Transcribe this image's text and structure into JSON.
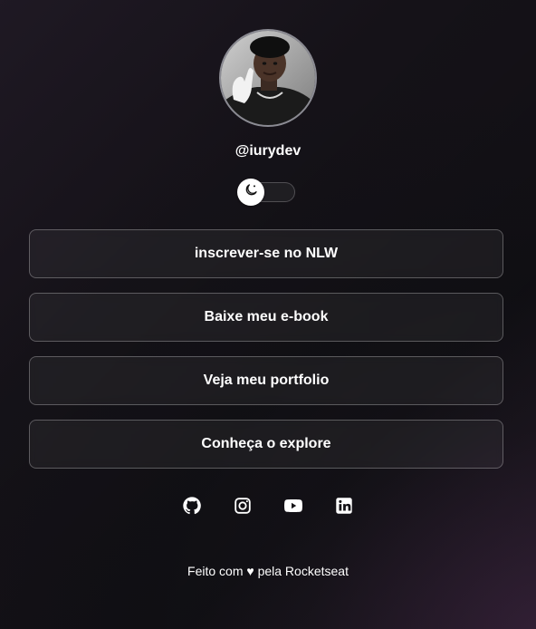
{
  "profile": {
    "handle": "@iurydev",
    "avatar_alt": "avatar"
  },
  "theme_switch": {
    "icon": "moon-icon"
  },
  "links": [
    {
      "label": "inscrever-se no NLW"
    },
    {
      "label": "Baixe meu e-book"
    },
    {
      "label": "Veja meu portfolio"
    },
    {
      "label": "Conheça o explore"
    }
  ],
  "socials": [
    {
      "name": "github",
      "icon": "github-icon"
    },
    {
      "name": "instagram",
      "icon": "instagram-icon"
    },
    {
      "name": "youtube",
      "icon": "youtube-icon"
    },
    {
      "name": "linkedin",
      "icon": "linkedin-icon"
    }
  ],
  "footer": {
    "text": "Feito com ♥ pela Rocketseat"
  },
  "colors": {
    "background": "#141217",
    "text": "#ffffff",
    "border": "#5c5a60"
  }
}
